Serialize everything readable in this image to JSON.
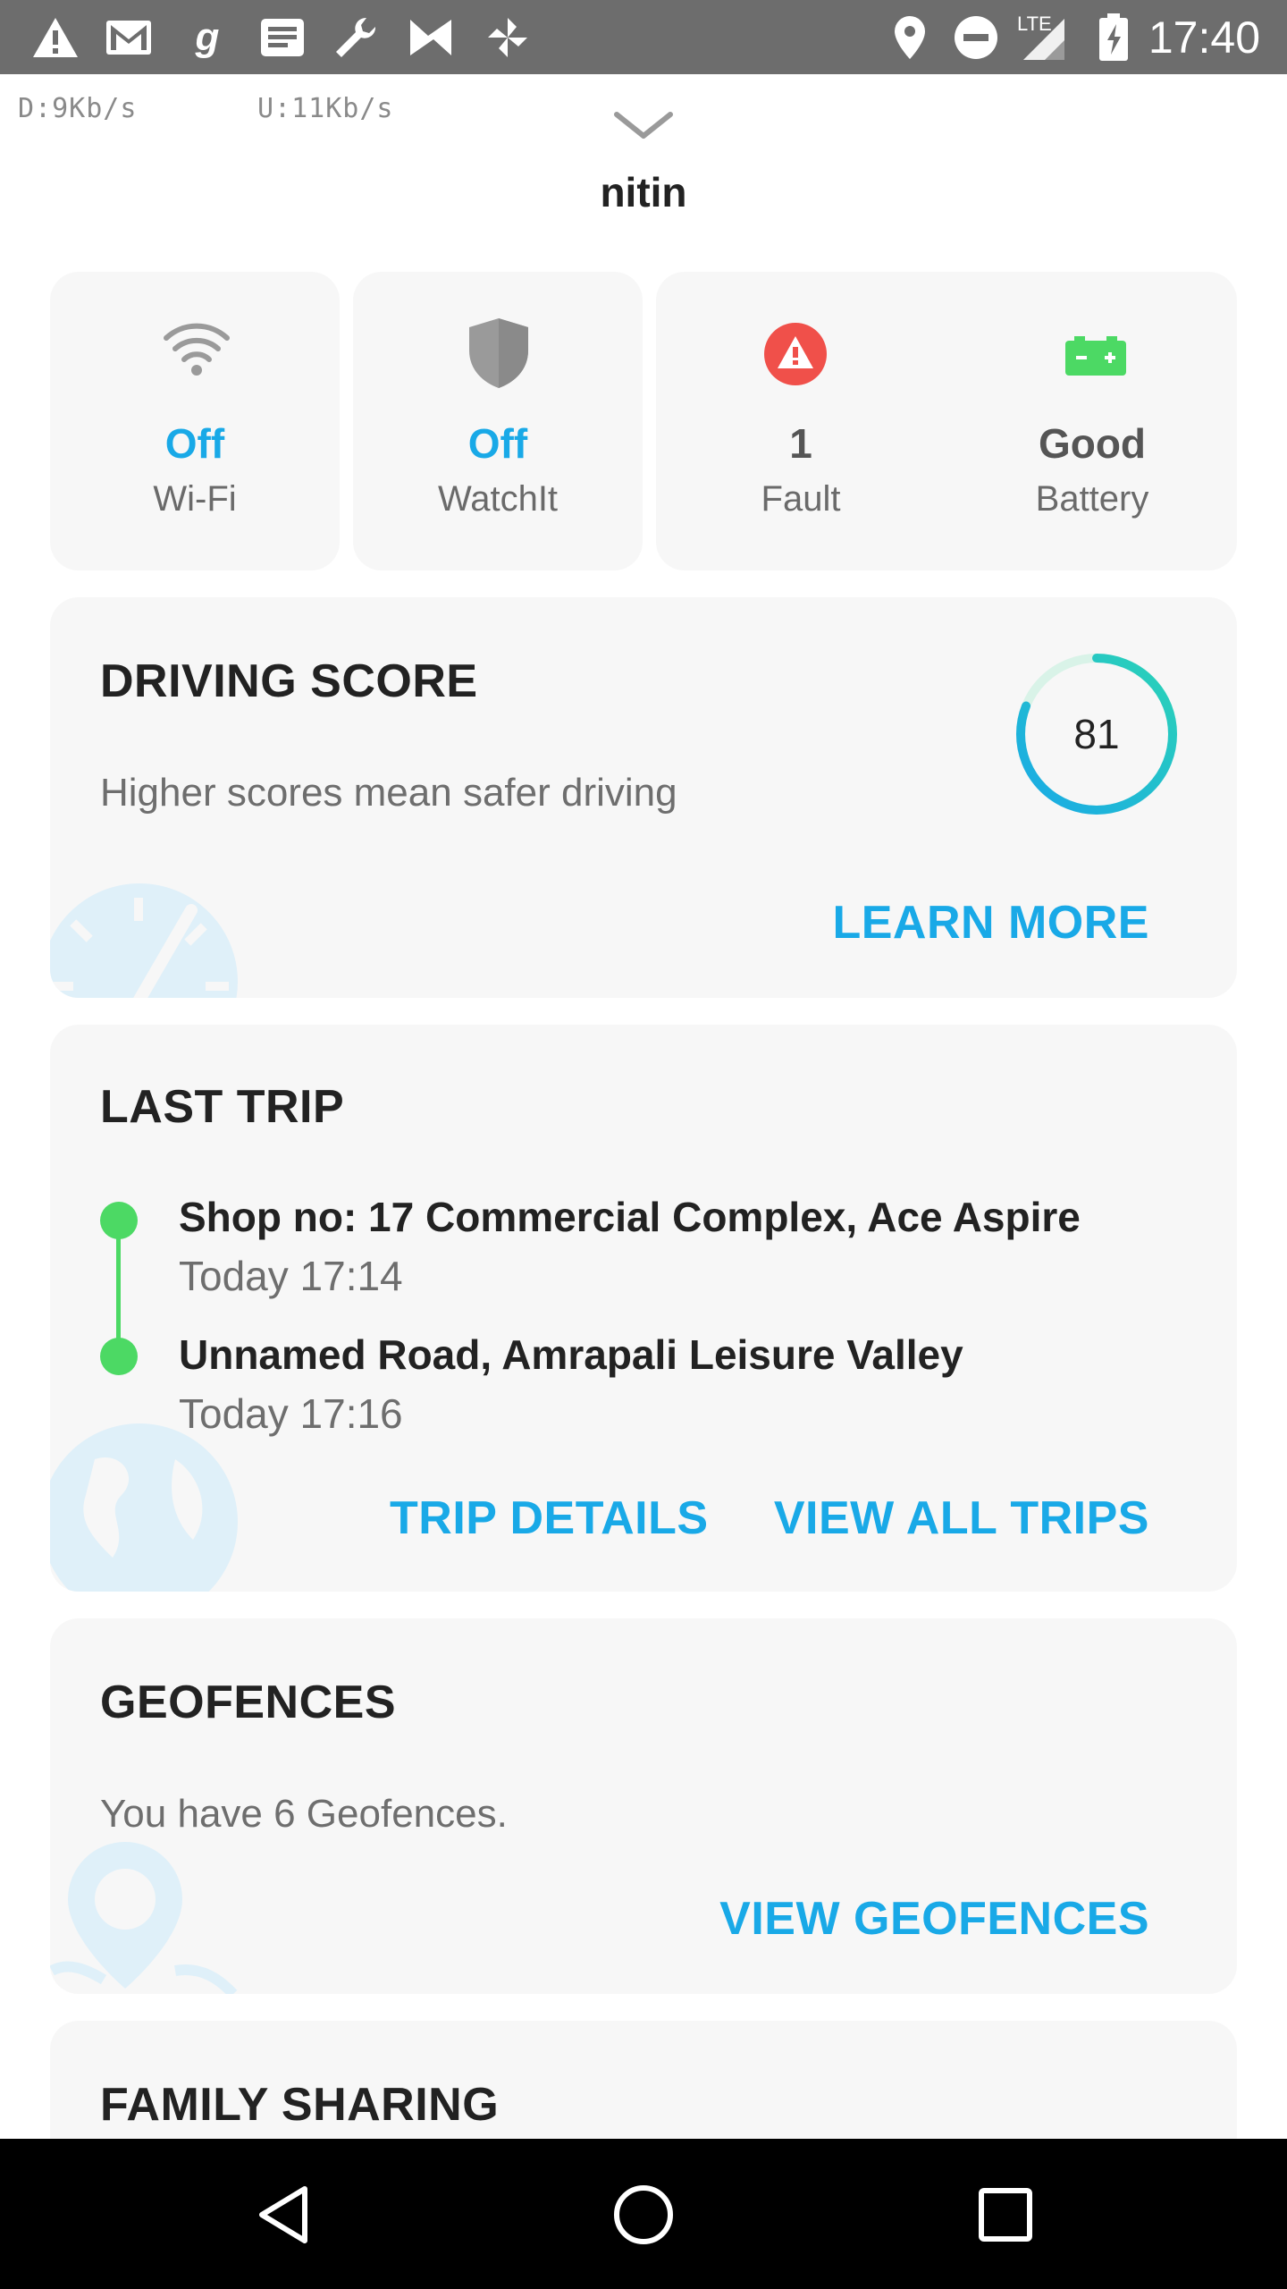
{
  "status_bar": {
    "time": "17:40",
    "network": "LTE",
    "left_icons": [
      "warning-icon",
      "gmail-icon",
      "g-icon",
      "message-icon",
      "wrench-icon",
      "n-icon",
      "pinwheel-icon"
    ],
    "right_icons": [
      "location-icon",
      "do-not-disturb-icon",
      "signal-icon",
      "battery-charging-icon"
    ]
  },
  "speed_overlay": {
    "download": "D:9Kb/s",
    "upload": "U:11Kb/s"
  },
  "header": {
    "username": "nitin"
  },
  "status_tiles": [
    {
      "value": "Off",
      "label": "Wi-Fi",
      "icon": "wifi-icon"
    },
    {
      "value": "Off",
      "label": "WatchIt",
      "icon": "shield-icon"
    },
    {
      "value": "1",
      "label": "Fault",
      "icon": "warning-icon"
    },
    {
      "value": "Good",
      "label": "Battery",
      "icon": "battery-icon"
    }
  ],
  "driving_score": {
    "title": "DRIVING SCORE",
    "subtitle": "Higher scores mean safer driving",
    "score": "81",
    "score_fraction": 0.81,
    "link": "LEARN MORE"
  },
  "last_trip": {
    "title": "LAST TRIP",
    "start_place": "Shop no: 17 Commercial Complex, Ace Aspire",
    "start_time": "Today 17:14",
    "end_place": "Unnamed Road, Amrapali Leisure Valley",
    "end_time": "Today 17:16",
    "link_details": "TRIP DETAILS",
    "link_all": "VIEW ALL TRIPS"
  },
  "geofences": {
    "title": "GEOFENCES",
    "text": "You have 6 Geofences.",
    "link": "VIEW GEOFENCES"
  },
  "family_sharing": {
    "title": "FAMILY SHARING"
  },
  "colors": {
    "accent": "#19a9e7",
    "green": "#4cd964",
    "fault": "#f0504a",
    "card_bg": "#f7f7f7"
  }
}
